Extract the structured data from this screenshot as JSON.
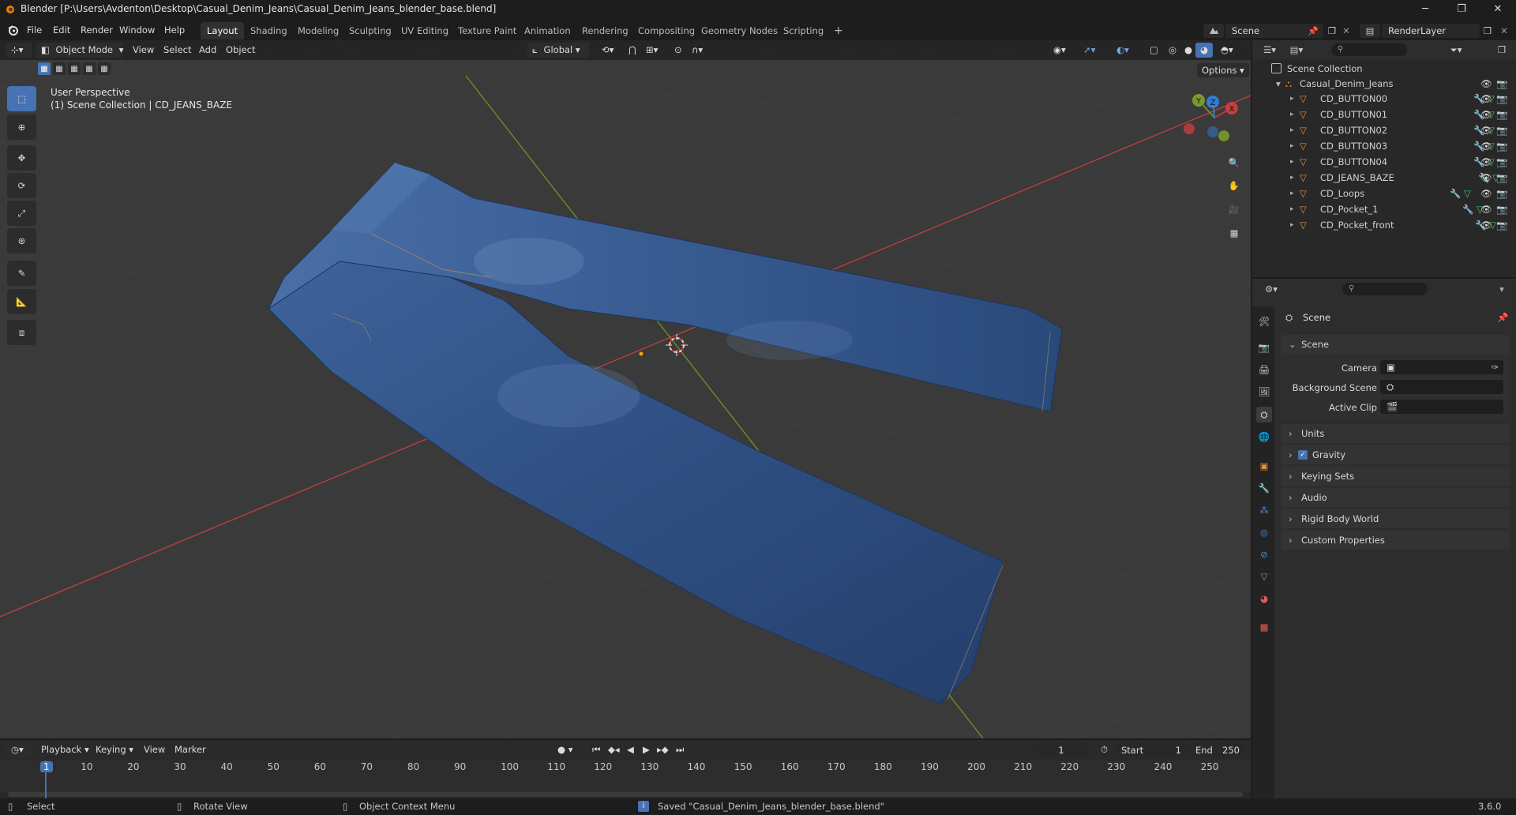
{
  "window": {
    "title": "Blender [P:\\Users\\Avdenton\\Desktop\\Casual_Denim_Jeans\\Casual_Denim_Jeans_blender_base.blend]"
  },
  "menu": [
    "File",
    "Edit",
    "Render",
    "Window",
    "Help"
  ],
  "workspaces": [
    "Layout",
    "Shading",
    "Modeling",
    "Sculpting",
    "UV Editing",
    "Texture Paint",
    "Animation",
    "Rendering",
    "Compositing",
    "Geometry Nodes",
    "Scripting"
  ],
  "active_workspace": "Layout",
  "scene_name": "Scene",
  "render_layer": "RenderLayer",
  "viewport": {
    "mode": "Object Mode",
    "menus": [
      "View",
      "Select",
      "Add",
      "Object"
    ],
    "orientation": "Global",
    "options_label": "Options",
    "info_line1": "User Perspective",
    "info_line2": "(1) Scene Collection | CD_JEANS_BAZE",
    "gizmo_axes": {
      "x": "X",
      "y": "Y",
      "z": "Z"
    }
  },
  "outliner": {
    "root": "Scene Collection",
    "collection": "Casual_Denim_Jeans",
    "objects": [
      "CD_BUTTON00",
      "CD_BUTTON01",
      "CD_BUTTON02",
      "CD_BUTTON03",
      "CD_BUTTON04",
      "CD_JEANS_BAZE",
      "CD_Loops",
      "CD_Pocket_1",
      "CD_Pocket_front"
    ]
  },
  "properties": {
    "context_title": "Scene",
    "panel_title": "Scene",
    "fields": [
      {
        "label": "Camera",
        "value": ""
      },
      {
        "label": "Background Scene",
        "value": ""
      },
      {
        "label": "Active Clip",
        "value": ""
      }
    ],
    "collapsed_panels": [
      "Units",
      "Gravity",
      "Keying Sets",
      "Audio",
      "Rigid Body World",
      "Custom Properties"
    ],
    "gravity_enabled": true
  },
  "timeline": {
    "menus": [
      "Playback",
      "Keying",
      "View",
      "Marker"
    ],
    "current_frame": "1",
    "start_label": "Start",
    "start": "1",
    "end_label": "End",
    "end": "250",
    "ruler": [
      "1",
      "10",
      "20",
      "30",
      "40",
      "50",
      "60",
      "70",
      "80",
      "90",
      "100",
      "110",
      "120",
      "130",
      "140",
      "150",
      "160",
      "170",
      "180",
      "190",
      "200",
      "210",
      "220",
      "230",
      "240",
      "250"
    ]
  },
  "status": {
    "select": "Select",
    "rotate": "Rotate View",
    "context_menu": "Object Context Menu",
    "message": "Saved \"Casual_Denim_Jeans_blender_base.blend\"",
    "version": "3.6.0"
  },
  "colors": {
    "accent": "#4772b3",
    "x_axis": "#c03a3a",
    "y_axis": "#7a9a2a",
    "z_axis": "#2e7fd8",
    "mesh_icon": "#e8903a",
    "denim": "#34588f"
  }
}
